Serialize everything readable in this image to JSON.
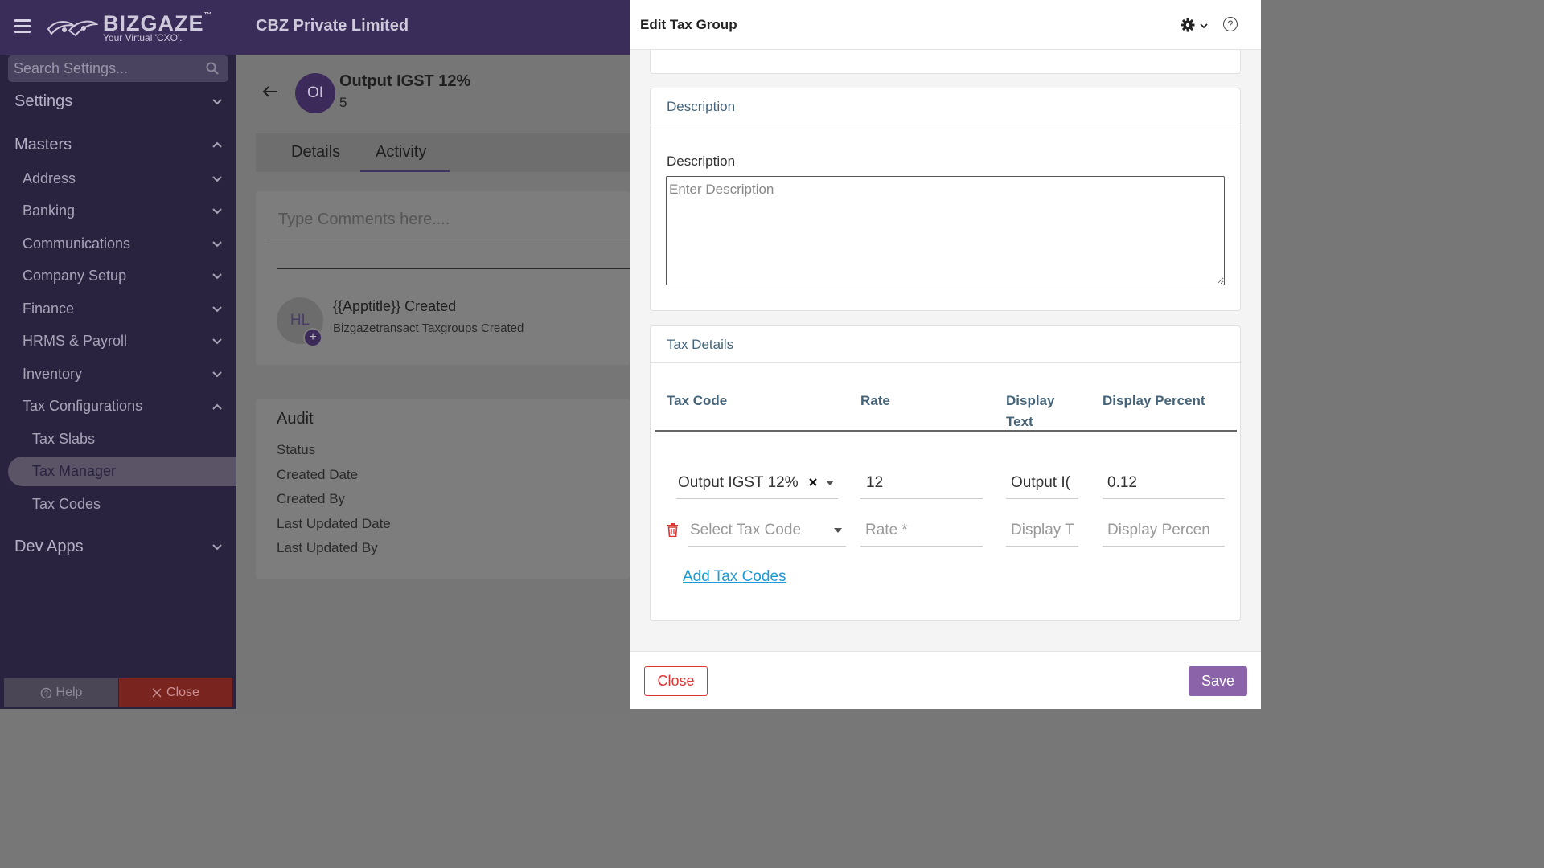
{
  "app": {
    "brand": "BIZGAZE",
    "brand_tm": "™",
    "tagline": "Your Virtual 'CXO'.",
    "company": "CBZ Private Limited"
  },
  "sidebar": {
    "search_placeholder": "Search Settings...",
    "sections": {
      "settings": "Settings",
      "masters": "Masters",
      "dev_apps": "Dev Apps"
    },
    "items": {
      "address": "Address",
      "banking": "Banking",
      "communications": "Communications",
      "company_setup": "Company Setup",
      "finance": "Finance",
      "hrms": "HRMS & Payroll",
      "inventory": "Inventory",
      "tax_configurations": "Tax Configurations"
    },
    "sub_items": {
      "tax_slabs": "Tax Slabs",
      "tax_manager": "Tax Manager",
      "tax_codes": "Tax Codes"
    },
    "help_label": "Help",
    "close_label": "Close"
  },
  "record": {
    "avatar": "OI",
    "title": "Output IGST 12%",
    "subtitle": "5",
    "tabs": {
      "details": "Details",
      "activity": "Activity"
    },
    "comment_placeholder": "Type Comments here....",
    "activity": {
      "avatar": "HL",
      "plus": "+",
      "title": "{{Apptitle}} Created",
      "subtitle": "Bizgazetransact Taxgroups Created"
    },
    "audit": {
      "title": "Audit",
      "rows": [
        "Status",
        "Created Date",
        "Created By",
        "Last Updated Date",
        "Last Updated By"
      ]
    }
  },
  "drawer": {
    "title": "Edit Tax Group",
    "help": "?",
    "description_section": "Description",
    "description_label": "Description",
    "description_placeholder": "Enter Description",
    "tax_section": "Tax Details",
    "columns": {
      "tax_code": "Tax Code",
      "rate": "Rate",
      "display_text": "Display Text",
      "display_percent": "Display Percent"
    },
    "row1": {
      "tax_code": "Output IGST 12%",
      "rate": "12",
      "display_text": "Output I(",
      "display_percent": "0.12"
    },
    "row2": {
      "tax_code_placeholder": "Select Tax Code",
      "rate_placeholder": "Rate *",
      "display_text_placeholder": "Display T",
      "display_percent_placeholder": "Display Percen"
    },
    "add_tax_codes": "Add Tax Codes",
    "close_label": "Close",
    "save_label": "Save"
  },
  "colors": {
    "sidebar_bg": "#2a2340",
    "accent_purple": "#8a63a8",
    "danger": "#dd3333",
    "link": "#1a9bd7",
    "section_heading": "#45647a"
  }
}
